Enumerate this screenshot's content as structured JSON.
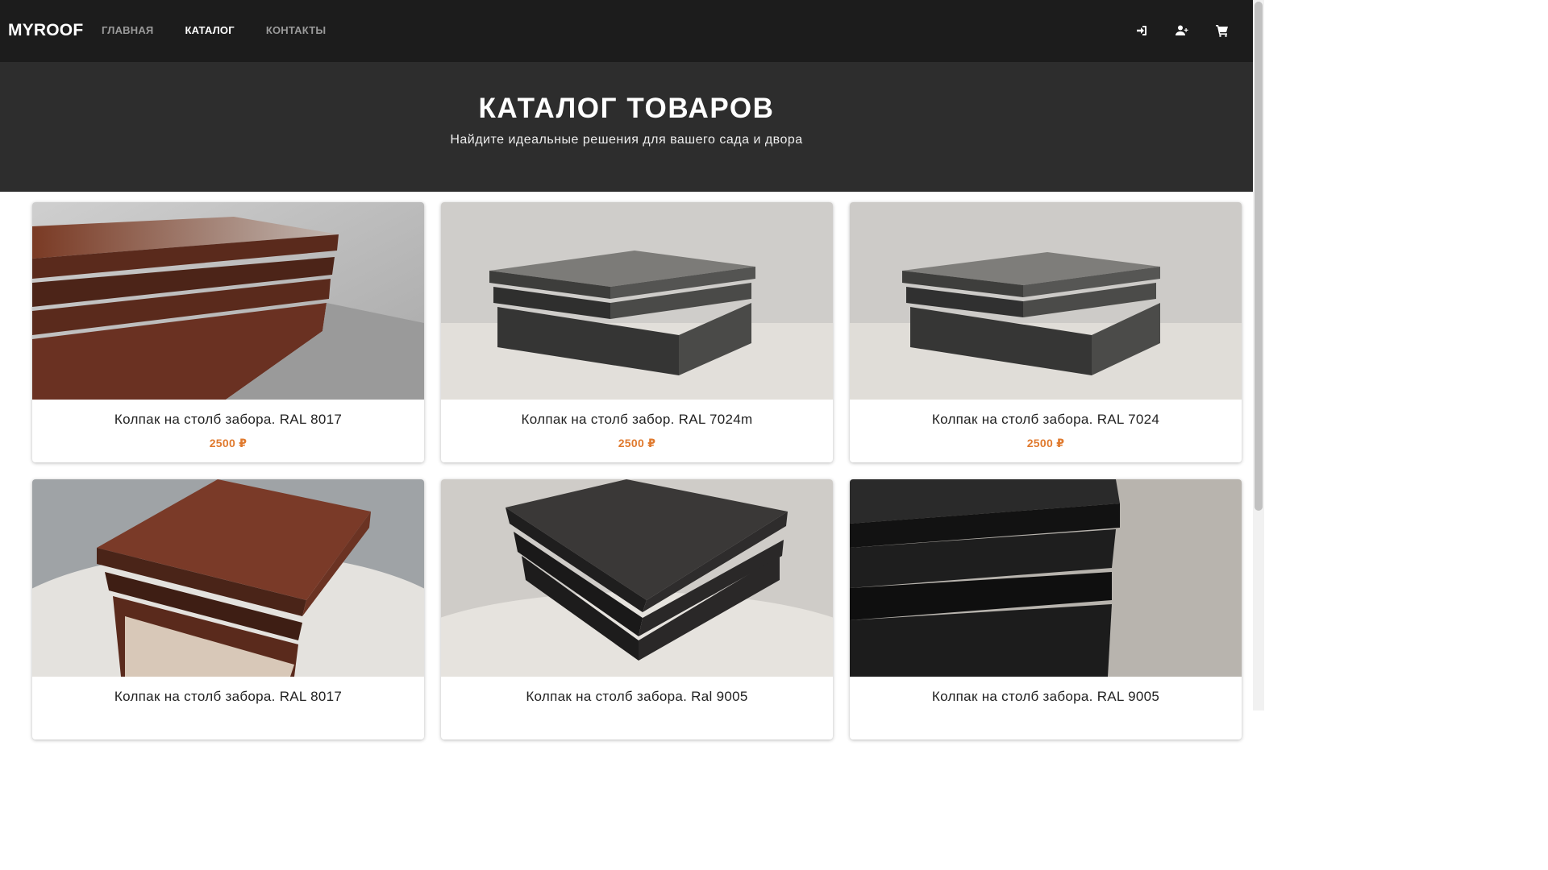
{
  "brand": "MYROOF",
  "nav": {
    "links": [
      {
        "label": "ГЛАВНАЯ",
        "active": false
      },
      {
        "label": "КАТАЛОГ",
        "active": true
      },
      {
        "label": "КОНТАКТЫ",
        "active": false
      }
    ],
    "icons": [
      "sign-in-icon",
      "user-plus-icon",
      "cart-icon"
    ]
  },
  "hero": {
    "title": "КАТАЛОГ ТОВАРОВ",
    "subtitle": "Найдите идеальные решения для вашего сада и двора"
  },
  "products": [
    {
      "title": "Колпак на столб забора. RAL 8017",
      "price": "2500 ₽",
      "color": "#5a2a1c"
    },
    {
      "title": "Колпак на столб забор. RAL 7024m",
      "price": "2500 ₽",
      "color": "#4a4a48"
    },
    {
      "title": "Колпак на столб забора. RAL 7024",
      "price": "2500 ₽",
      "color": "#4a4a48"
    },
    {
      "title": "Колпак на столб забора. RAL 8017",
      "price": "",
      "color": "#6b3323"
    },
    {
      "title": "Колпак на столб забора. Ral 9005",
      "price": "",
      "color": "#2a2828"
    },
    {
      "title": "Колпак на столб забора. RAL 9005",
      "price": "",
      "color": "#1a1a1a"
    }
  ],
  "colors": {
    "navbar": "#1c1c1c",
    "hero": "#2d2d2d",
    "price": "#e07a2e"
  }
}
